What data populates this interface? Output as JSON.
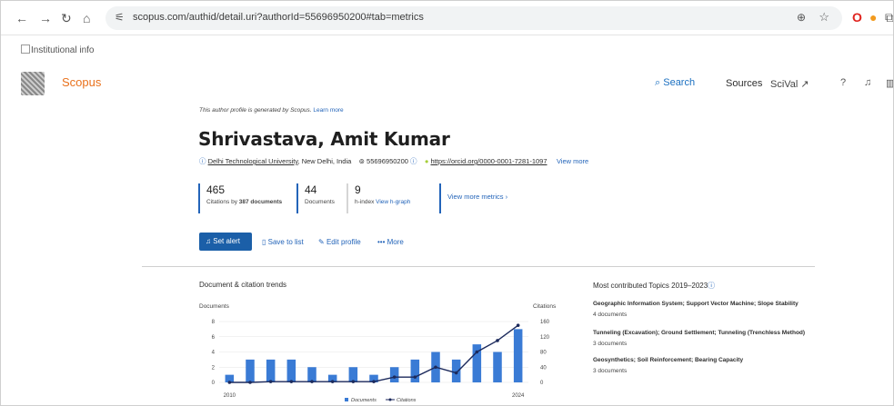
{
  "browser": {
    "url": "scopus.com/authid/detail.uri?authorId=55696950200#tab=metrics"
  },
  "institutional_alt": "Institutional info",
  "header": {
    "brand": "Scopus",
    "search": "Search",
    "sources": "Sources",
    "scival": "SciVal ↗"
  },
  "profile": {
    "note": "This author profile is generated by Scopus.",
    "note_link": "Learn more",
    "name": "Shrivastava, Amit Kumar",
    "affiliation": "Delhi Technological University",
    "location": ", New Delhi, India",
    "author_id": "55696950200",
    "orcid": "https://orcid.org/0000-0001-7281-1097",
    "view_more": "View more"
  },
  "metrics": {
    "citations_value": "465",
    "citations_label_prefix": "Citations by ",
    "citations_docs": "387 documents",
    "documents_value": "44",
    "documents_label": "Documents",
    "hindex_value": "9",
    "hindex_label": "h-index",
    "hindex_link": "View h-graph",
    "view_more_metrics": "View more metrics"
  },
  "actions": {
    "set_alert": "Set alert",
    "save_to_list": "Save to list",
    "edit_profile": "Edit profile",
    "more": "More"
  },
  "trends": {
    "title": "Document & citation trends",
    "left_axis": "Documents",
    "right_axis": "Citations",
    "legend_documents": "Documents",
    "legend_citations": "Citations"
  },
  "topics": {
    "title": "Most contributed Topics 2019–2023",
    "items": [
      {
        "name": "Geographic Information System; Support Vector Machine; Slope Stability",
        "count": "4 documents"
      },
      {
        "name": "Tunneling (Excavation); Ground Settlement; Tunneling (Trenchless Method)",
        "count": "3 documents"
      },
      {
        "name": "Geosynthetics; Soil Reinforcement; Bearing Capacity",
        "count": "3 documents"
      }
    ]
  },
  "colors": {
    "accent": "#2364b9",
    "brand_orange": "#e9711c",
    "bar_blue": "#3a7bd5",
    "line_navy": "#1c2a5c"
  },
  "chart_data": {
    "type": "bar",
    "title": "Document & citation trends",
    "categories": [
      2010,
      2011,
      2012,
      2013,
      2014,
      2015,
      2016,
      2017,
      2018,
      2019,
      2020,
      2021,
      2022,
      2023,
      2024
    ],
    "x_tick_labels": [
      "2010",
      "2024"
    ],
    "series": [
      {
        "name": "Documents",
        "type": "bar",
        "axis": "left",
        "values": [
          1,
          3,
          3,
          3,
          2,
          1,
          2,
          1,
          2,
          3,
          4,
          3,
          5,
          4,
          7
        ]
      },
      {
        "name": "Citations",
        "type": "line",
        "axis": "right",
        "values": [
          0,
          0,
          2,
          2,
          2,
          2,
          2,
          2,
          14,
          14,
          40,
          25,
          80,
          110,
          150
        ]
      }
    ],
    "ylabel_left": "Documents",
    "ylim_left": [
      0,
      8
    ],
    "yticks_left": [
      0,
      2,
      4,
      6,
      8
    ],
    "ylabel_right": "Citations",
    "ylim_right": [
      0,
      160
    ],
    "yticks_right": [
      0,
      40,
      80,
      120,
      160
    ],
    "legend": "bottom"
  }
}
